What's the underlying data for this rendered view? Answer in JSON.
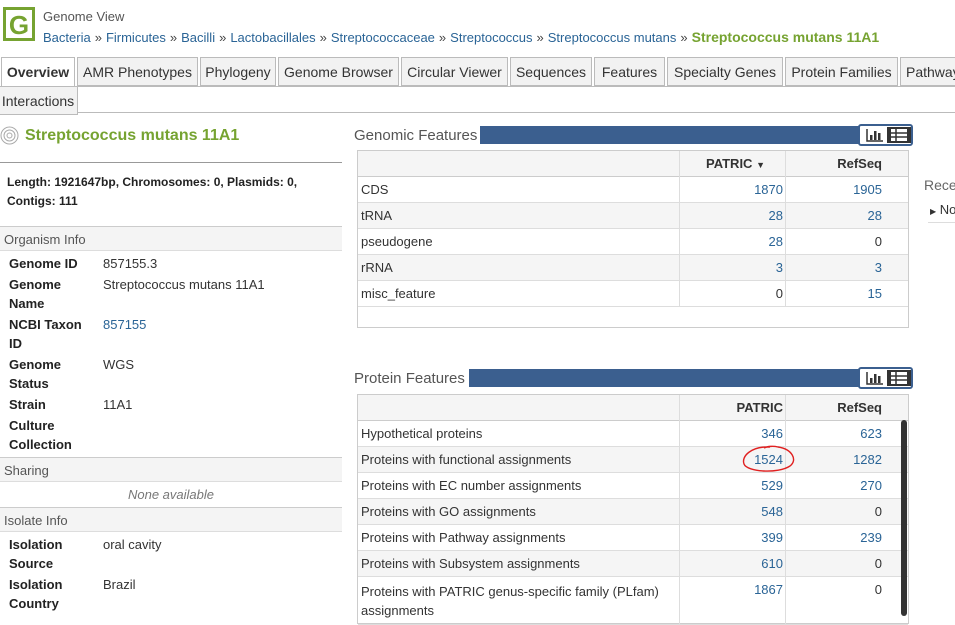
{
  "header": {
    "title": "Genome View",
    "logo_letter": "G",
    "breadcrumb": [
      "Bacteria",
      "Firmicutes",
      "Bacilli",
      "Lactobacillales",
      "Streptococcaceae",
      "Streptococcus",
      "Streptococcus mutans"
    ],
    "breadcrumb_separator": "»",
    "breadcrumb_current": "Streptococcus mutans 11A1"
  },
  "tabs": [
    "Overview",
    "AMR Phenotypes",
    "Phylogeny",
    "Genome Browser",
    "Circular Viewer",
    "Sequences",
    "Features",
    "Specialty Genes",
    "Protein Families",
    "Pathways",
    "Interactions"
  ],
  "active_tab": "Overview",
  "organism": {
    "title": "Streptococcus mutans 11A1",
    "summary": "Length: 1921647bp, Chromosomes: 0, Plasmids: 0, Contigs: 111"
  },
  "organism_info": {
    "header": "Organism Info",
    "genome_id_label": "Genome ID",
    "genome_id": "857155.3",
    "genome_name_label": "Genome Name",
    "genome_name": "Streptococcus mutans 11A1",
    "taxon_label": "NCBI Taxon ID",
    "taxon": "857155",
    "status_label": "Genome Status",
    "status": "WGS",
    "strain_label": "Strain",
    "strain": "11A1",
    "culture_label": "Culture Collection"
  },
  "sharing": {
    "header": "Sharing",
    "value": "None available"
  },
  "isolate_info": {
    "header": "Isolate Info",
    "source_label": "Isolation Source",
    "source": "oral cavity",
    "country_label": "Isolation Country",
    "country": "Brazil"
  },
  "genomic_features": {
    "title": "Genomic Features",
    "columns": [
      "PATRIC",
      "RefSeq"
    ],
    "sort_icon": "sort-desc-icon",
    "rows": [
      {
        "name": "CDS",
        "patric": "1870",
        "refseq": "1905"
      },
      {
        "name": "tRNA",
        "patric": "28",
        "refseq": "28"
      },
      {
        "name": "pseudogene",
        "patric": "28",
        "refseq": "0"
      },
      {
        "name": "rRNA",
        "patric": "3",
        "refseq": "3"
      },
      {
        "name": "misc_feature",
        "patric": "0",
        "refseq": "15"
      }
    ]
  },
  "protein_features": {
    "title": "Protein Features",
    "columns": [
      "PATRIC",
      "RefSeq"
    ],
    "rows": [
      {
        "name": "Hypothetical proteins",
        "patric": "346",
        "refseq": "623"
      },
      {
        "name": "Proteins with functional assignments",
        "patric": "1524",
        "refseq": "1282"
      },
      {
        "name": "Proteins with EC number assignments",
        "patric": "529",
        "refseq": "270"
      },
      {
        "name": "Proteins with GO assignments",
        "patric": "548",
        "refseq": "0"
      },
      {
        "name": "Proteins with Pathway assignments",
        "patric": "399",
        "refseq": "239"
      },
      {
        "name": "Proteins with Subsystem assignments",
        "patric": "610",
        "refseq": "0"
      },
      {
        "name": "Proteins with PATRIC genus-specific family (PLfam) assignments",
        "patric": "1867",
        "refseq": "0"
      }
    ]
  },
  "recent": {
    "title": "Rece",
    "item": "No"
  },
  "colors": {
    "accent_green": "#76a331",
    "link_blue": "#2a6496",
    "panel_bar": "#3b5f8f",
    "annotation_red": "#e02020"
  }
}
